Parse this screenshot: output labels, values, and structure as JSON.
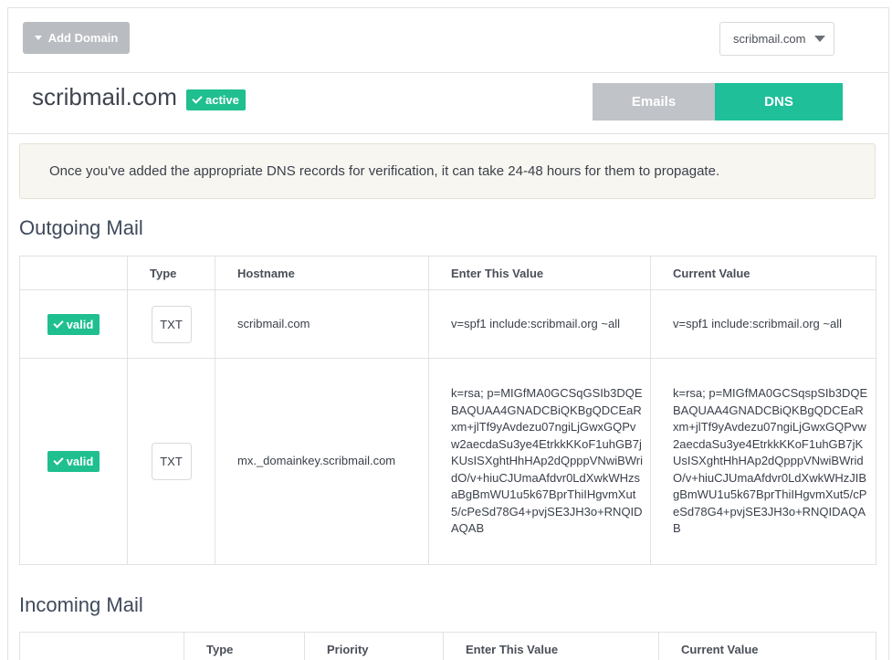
{
  "topbar": {
    "add_domain_label": "Add Domain",
    "domain_select_value": "scribmail.com"
  },
  "domain": {
    "name": "scribmail.com",
    "status": "active"
  },
  "tabs": [
    {
      "label": "Emails",
      "active": false
    },
    {
      "label": "DNS",
      "active": true
    }
  ],
  "notice": "Once you've added the appropriate DNS records for verification, it can take 24-48 hours for them to propagate.",
  "outgoing": {
    "title": "Outgoing Mail",
    "headers": [
      "",
      "Type",
      "Hostname",
      "Enter This Value",
      "Current Value"
    ],
    "rows": [
      {
        "status": "valid",
        "type": "TXT",
        "hostname": "scribmail.com",
        "enter_value": "v=spf1 include:scribmail.org ~all",
        "current_value": "v=spf1 include:scribmail.org ~all"
      },
      {
        "status": "valid",
        "type": "TXT",
        "hostname": "mx._domainkey.scribmail.com",
        "enter_value": "k=rsa; p=MIGfMA0GCSqGSIb3DQEBAQUAA4GNADCBiQKBgQDCEaRxm+jlTf9yAvdezu07ngiLjGwxGQPvw2aecdaSu3ye4EtrkkKKoF1uhGB7jKUsISXghtHhHAp2dQpppVNwiBWridO/v+hiuCJUmaAfdvr0LdXwkWHzsaBgBmWU1u5k67BprThiIHgvmXut5/cPeSd78G4+pvjSE3JH3o+RNQIDAQAB",
        "current_value": "k=rsa; p=MIGfMA0GCSqspSIb3DQEBAQUAA4GNADCBiQKBgQDCEaRxm+jlTf9yAvdezu07ngiLjGwxGQPvw2aecdaSu3ye4EtrkkKKoF1uhGB7jKUsISXghtHhHAp2dQpppVNwiBWridO/v+hiuCJUmaAfdvr0LdXwkWHzJIBgBmWU1u5k67BprThiIHgvmXut5/cPeSd78G4+pvjSE3JH3o+RNQIDAQAB"
      }
    ]
  },
  "incoming": {
    "title": "Incoming Mail",
    "headers": [
      "",
      "Type",
      "Priority",
      "Enter This Value",
      "Current Value"
    ]
  },
  "colors": {
    "accent": "#1fbf9a",
    "muted_button": "#b9bcc0",
    "notice_bg": "#f7f6f0"
  }
}
